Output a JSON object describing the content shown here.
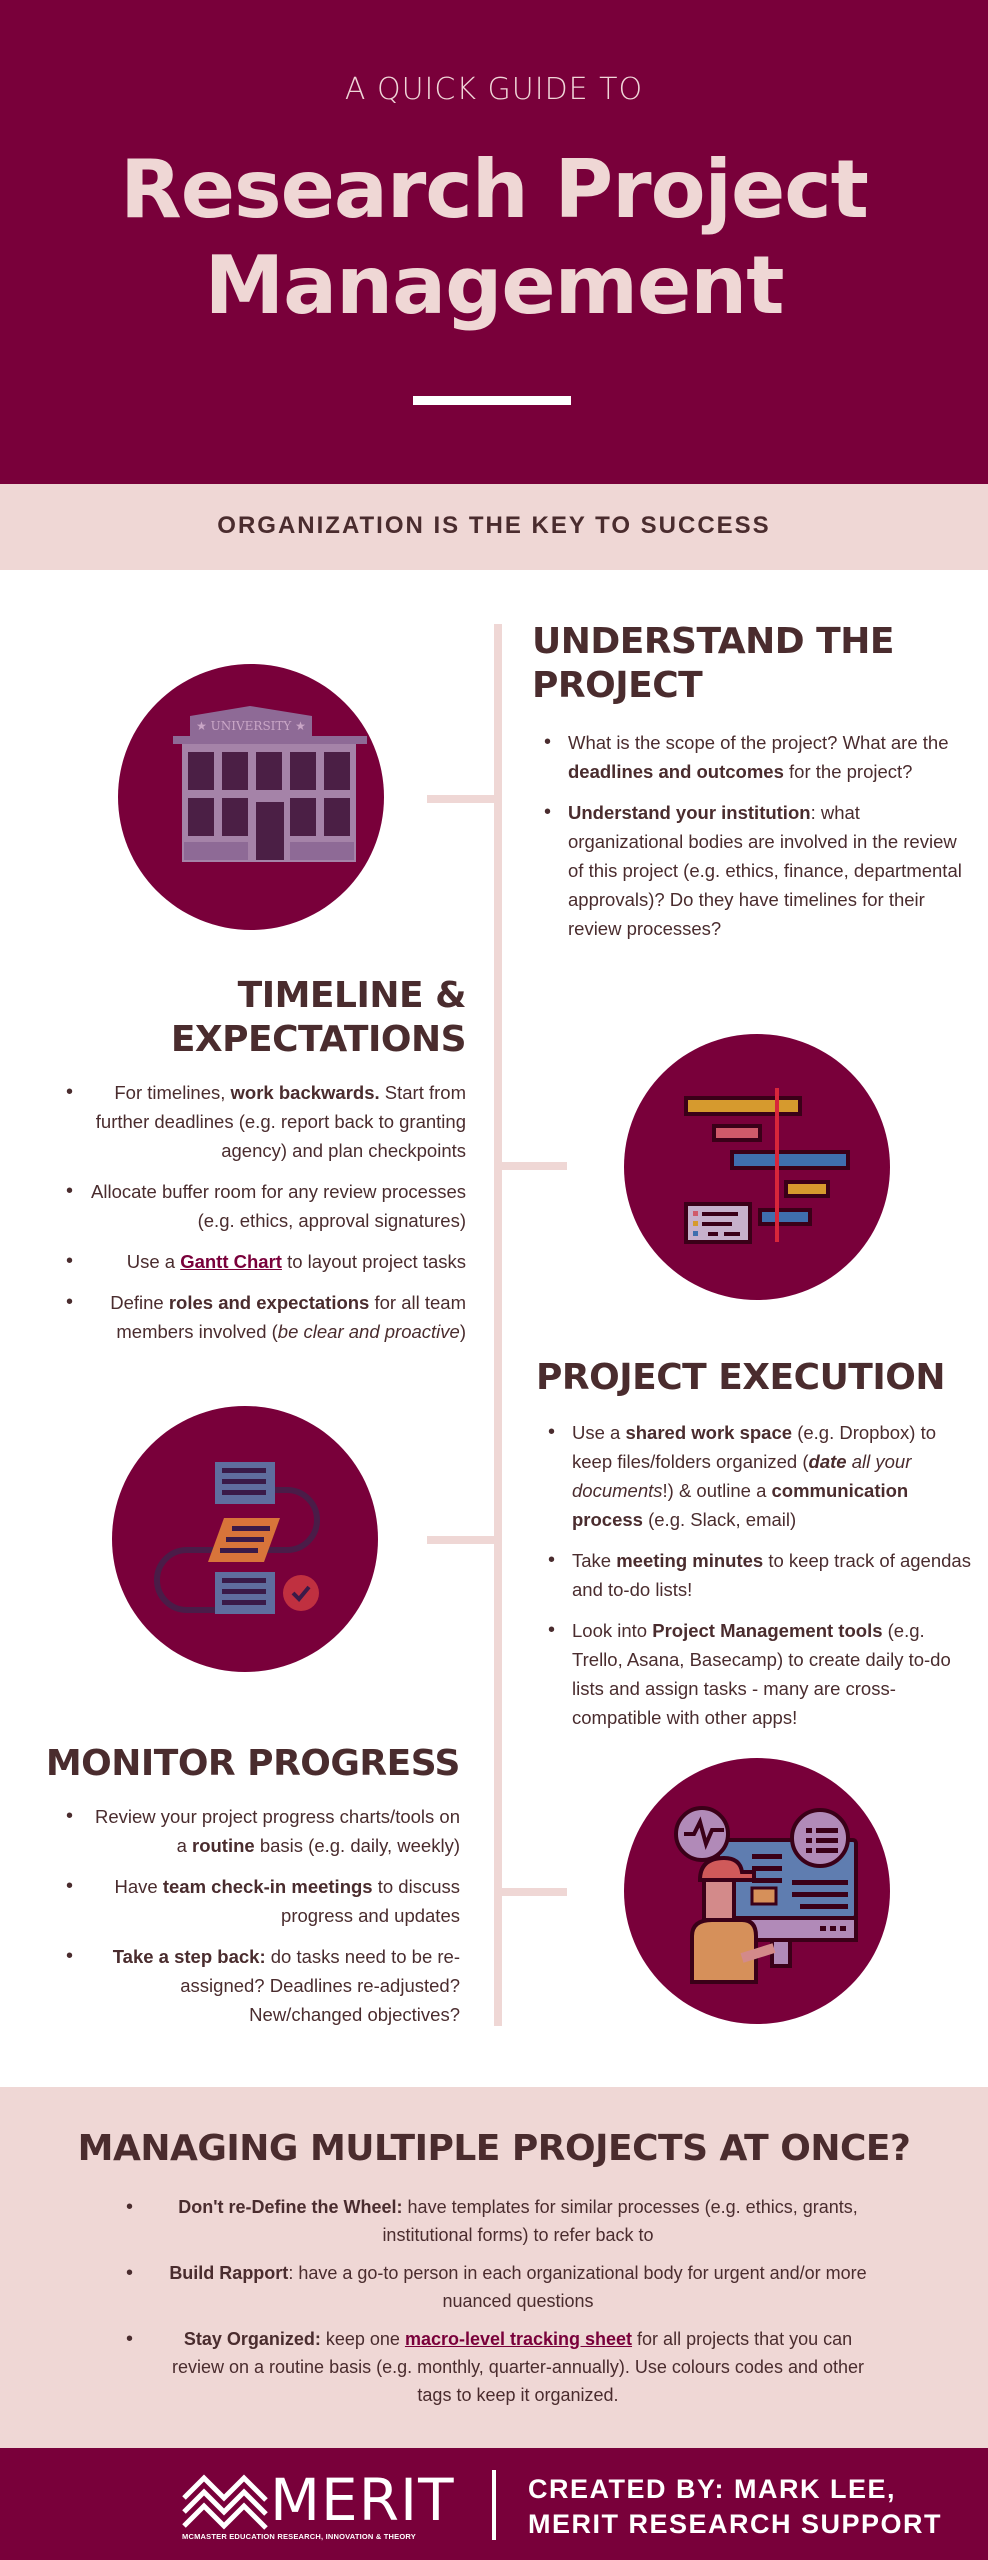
{
  "header": {
    "kicker": "A QUICK GUIDE TO",
    "title_line1": "Research Project",
    "title_line2": "Management"
  },
  "tagline": "ORGANIZATION IS THE KEY TO SUCCESS",
  "colors": {
    "primary": "#79003a",
    "blush": "#efd7d5",
    "text": "#4a2c2e"
  },
  "sections": {
    "understand": {
      "icon": "university-building-icon",
      "title_line1": "UNDERSTAND THE",
      "title_line2": "PROJECT",
      "bullets": [
        {
          "pre": "What is the scope of the project? What are the ",
          "bold": "deadlines and outcomes",
          "post": " for the project?"
        },
        {
          "bold": "Understand your institution",
          "post": ": what organizational bodies are involved in the review of this project (e.g. ethics, finance, departmental approvals)? Do they have timelines for their review processes?"
        }
      ]
    },
    "timeline": {
      "icon": "gantt-chart-icon",
      "title_line1": "TIMELINE &",
      "title_line2": "EXPECTATIONS",
      "bullets": [
        {
          "pre": "For timelines, ",
          "bold": "work backwards.",
          "post": " Start from further deadlines (e.g. report back to granting agency) and plan checkpoints"
        },
        {
          "text": "Allocate buffer room for any review processes (e.g. ethics, approval signatures)"
        },
        {
          "pre": "Use a ",
          "link": "Gantt Chart",
          "post": " to layout project tasks"
        },
        {
          "pre": "Define ",
          "bold": "roles and expectations",
          "mid": " for all team members involved (",
          "italic": "be clear and proactive",
          "post": ")"
        }
      ]
    },
    "execution": {
      "icon": "workflow-process-icon",
      "title": "PROJECT EXECUTION",
      "bullets": [
        {
          "pre": "Use a ",
          "bold": "shared work space",
          "mid": " (e.g. Dropbox) to keep files/folders organized (",
          "bolditalic": "date",
          "italic": " all your documents",
          "mid2": "!) & outline a ",
          "bold2": "communication process",
          "post": " (e.g. Slack, email)"
        },
        {
          "pre": "Take ",
          "bold": "meeting minutes",
          "post": " to keep track of agendas and to-do lists!"
        },
        {
          "pre": "Look into ",
          "bold": "Project Management tools",
          "post": " (e.g. Trello, Asana, Basecamp) to create daily to-do lists and assign tasks - many are cross-compatible with other apps!"
        }
      ]
    },
    "monitor": {
      "icon": "computer-monitoring-icon",
      "title": "MONITOR PROGRESS",
      "bullets": [
        {
          "pre": "Review your project progress charts/tools on a ",
          "bold": "routine",
          "post": " basis (e.g. daily, weekly)"
        },
        {
          "pre": "Have ",
          "bold": "team check-in meetings",
          "post": " to discuss progress and updates"
        },
        {
          "bold": "Take a step back:",
          "post": " do tasks need to be re-assigned? Deadlines re-adjusted? New/changed objectives?"
        }
      ]
    }
  },
  "multiple": {
    "title": "MANAGING MULTIPLE PROJECTS AT ONCE?",
    "bullets": [
      {
        "bold": "Don't re-Define the Wheel:",
        "post": " have templates for similar processes (e.g. ethics, grants, institutional forms) to refer back to"
      },
      {
        "bold": "Build Rapport",
        "post": ": have a go-to person in each organizational body for urgent and/or more nuanced questions"
      },
      {
        "bold": "Stay Organized:",
        "pre2": " keep one ",
        "link": "macro-level tracking sheet",
        "post": " for all projects that you can review on a routine basis (e.g. monthly, quarter-annually). Use colours codes and other tags to keep it organized."
      }
    ]
  },
  "footer": {
    "logo_word": "MERIT",
    "logo_subtitle": "MCMASTER EDUCATION RESEARCH, INNOVATION & THEORY",
    "credit_line1": "CREATED BY: MARK LEE,",
    "credit_line2": "MERIT RESEARCH SUPPORT"
  }
}
